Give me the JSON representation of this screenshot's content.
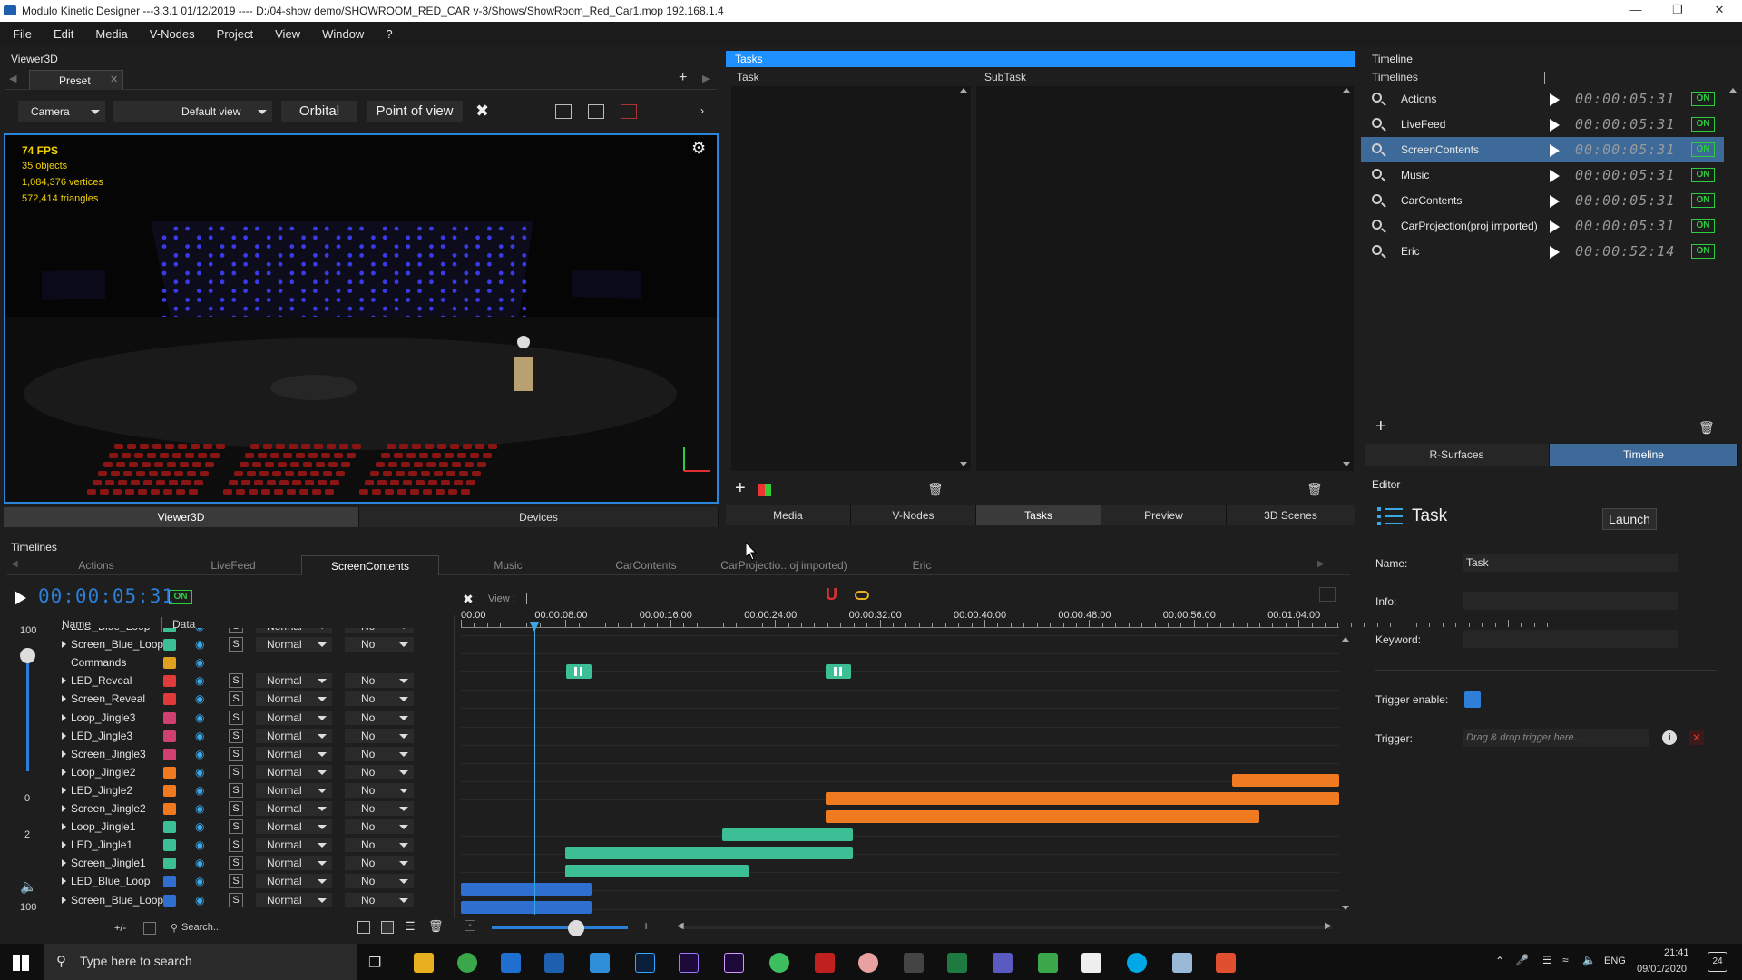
{
  "window": {
    "title": "Modulo Kinetic Designer ---3.3.1 01/12/2019  ----  D:/04-show demo/SHOWROOM_RED_CAR v-3/Shows/ShowRoom_Red_Car1.mop   192.168.1.4"
  },
  "menu": [
    "File",
    "Edit",
    "Media",
    "V-Nodes",
    "Project",
    "View",
    "Window",
    "?"
  ],
  "viewer": {
    "panel_title": "Viewer3D",
    "preset_tab": "Preset",
    "camera": "Camera",
    "view": "Default view",
    "orbital": "Orbital",
    "pov": "Point of view",
    "stats": {
      "fps": "74 FPS",
      "objects": "35 objects",
      "vertices": "1,084,376 vertices",
      "triangles": "572,414 triangles"
    },
    "bottom_tabs": [
      "Viewer3D",
      "Devices"
    ]
  },
  "tasks": {
    "panel_title": "Tasks",
    "col_task": "Task",
    "col_subtask": "SubTask",
    "bottom_tabs": [
      "Media",
      "V-Nodes",
      "Tasks",
      "Preview",
      "3D Scenes"
    ],
    "active_tab": "Tasks"
  },
  "timeline_panel": {
    "panel_title": "Timeline",
    "col_header": "Timelines",
    "rows": [
      {
        "name": "Actions",
        "tc": "00:00:05:31",
        "on": "ON",
        "selected": false
      },
      {
        "name": "LiveFeed",
        "tc": "00:00:05:31",
        "on": "ON",
        "selected": false
      },
      {
        "name": "ScreenContents",
        "tc": "00:00:05:31",
        "on": "ON",
        "selected": true
      },
      {
        "name": "Music",
        "tc": "00:00:05:31",
        "on": "ON",
        "selected": false
      },
      {
        "name": "CarContents",
        "tc": "00:00:05:31",
        "on": "ON",
        "selected": false
      },
      {
        "name": "CarProjection(proj imported)",
        "tc": "00:00:05:31",
        "on": "ON",
        "selected": false
      },
      {
        "name": "Eric",
        "tc": "00:00:52:14",
        "on": "ON",
        "selected": false
      }
    ],
    "tabs": [
      "R-Surfaces",
      "Timeline"
    ],
    "active_tab": "Timeline"
  },
  "editor": {
    "panel_title": "Editor",
    "heading": "Task",
    "launch": "Launch",
    "name_label": "Name:",
    "name_value": "Task",
    "info_label": "Info:",
    "keyword_label": "Keyword:",
    "trigger_enable_label": "Trigger enable:",
    "trigger_label": "Trigger:",
    "trigger_placeholder": "Drag & drop trigger here..."
  },
  "timelines": {
    "panel_title": "Timelines",
    "tabs": [
      "Actions",
      "LiveFeed",
      "ScreenContents",
      "Music",
      "CarContents",
      "CarProjectio...oj imported)",
      "Eric"
    ],
    "active_tab": "ScreenContents",
    "timecode": "00:00:05:31",
    "on": "ON",
    "view_label": "View :",
    "col_name": "Name",
    "col_data": "Data",
    "ruler": [
      "00:00",
      "00:00:08:00",
      "00:00:16:00",
      "00:00:24:00",
      "00:00:32:00",
      "00:00:40:00",
      "00:00:48:00",
      "00:00:56:00",
      "00:01:04:00"
    ],
    "side_values": {
      "vol_top": "100",
      "zero": "0",
      "two": "2",
      "vol_bottom": "100"
    },
    "plus_minus": "+/-",
    "search": "Search...",
    "rows": [
      {
        "name": "LED_Blue_Loop",
        "color": "#3dbf96",
        "mode": "Normal",
        "blend": "No",
        "has_arrow": true
      },
      {
        "name": "Screen_Blue_Loop",
        "color": "#3dbf96",
        "mode": "Normal",
        "blend": "No",
        "has_arrow": true
      },
      {
        "name": "Commands",
        "color": "#e0a020",
        "mode": "",
        "blend": "",
        "has_arrow": false
      },
      {
        "name": "LED_Reveal",
        "color": "#e03a3a",
        "mode": "Normal",
        "blend": "No",
        "has_arrow": true
      },
      {
        "name": "Screen_Reveal",
        "color": "#e03a3a",
        "mode": "Normal",
        "blend": "No",
        "has_arrow": true
      },
      {
        "name": "Loop_Jingle3",
        "color": "#d04070",
        "mode": "Normal",
        "blend": "No",
        "has_arrow": true
      },
      {
        "name": "LED_Jingle3",
        "color": "#d04070",
        "mode": "Normal",
        "blend": "No",
        "has_arrow": true
      },
      {
        "name": "Screen_Jingle3",
        "color": "#d04070",
        "mode": "Normal",
        "blend": "No",
        "has_arrow": true
      },
      {
        "name": "Loop_Jingle2",
        "color": "#f07a20",
        "mode": "Normal",
        "blend": "No",
        "has_arrow": true
      },
      {
        "name": "LED_Jingle2",
        "color": "#f07a20",
        "mode": "Normal",
        "blend": "No",
        "has_arrow": true
      },
      {
        "name": "Screen_Jingle2",
        "color": "#f07a20",
        "mode": "Normal",
        "blend": "No",
        "has_arrow": true
      },
      {
        "name": "Loop_Jingle1",
        "color": "#3dbf96",
        "mode": "Normal",
        "blend": "No",
        "has_arrow": true
      },
      {
        "name": "LED_Jingle1",
        "color": "#3dbf96",
        "mode": "Normal",
        "blend": "No",
        "has_arrow": true
      },
      {
        "name": "Screen_Jingle1",
        "color": "#3dbf96",
        "mode": "Normal",
        "blend": "No",
        "has_arrow": true
      },
      {
        "name": "LED_Blue_Loop",
        "color": "#2f6fd0",
        "mode": "Normal",
        "blend": "No",
        "has_arrow": true
      },
      {
        "name": "Screen_Blue_Loop",
        "color": "#2f6fd0",
        "mode": "Normal",
        "blend": "No",
        "has_arrow": true
      }
    ]
  },
  "taskbar": {
    "search_placeholder": "Type here to search",
    "lang": "ENG",
    "time": "21:41",
    "date": "09/01/2020",
    "notif": "24"
  },
  "colors": {
    "accent": "#1e90ff",
    "on_green": "#2ecc40",
    "selected_row": "#3d6a99"
  }
}
